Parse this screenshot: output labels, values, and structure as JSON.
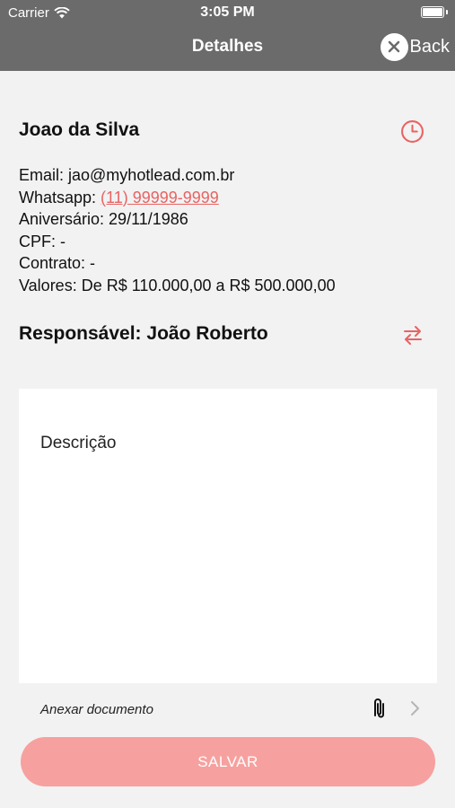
{
  "status_bar": {
    "carrier": "Carrier",
    "time": "3:05 PM"
  },
  "nav": {
    "title": "Detalhes",
    "back_label": "Back"
  },
  "contact": {
    "name": "Joao da Silva",
    "email_label": "Email: ",
    "email": "jao@myhotlead.com.br",
    "whatsapp_label": "Whatsapp: ",
    "whatsapp": "(11) 99999-9999",
    "aniversario_label": "Aniversário: ",
    "aniversario": "29/11/1986",
    "cpf_label": "CPF: ",
    "cpf": "-",
    "contrato_label": "Contrato: ",
    "contrato": "-",
    "valores_label": "Valores: ",
    "valores": "De R$ 110.000,00 a R$ 500.000,00"
  },
  "responsavel": {
    "text": "Responsável: João Roberto"
  },
  "description": {
    "placeholder": "Descrição"
  },
  "attachment": {
    "label": "Anexar documento"
  },
  "save_button": {
    "label": "SALVAR"
  },
  "colors": {
    "accent": "#e96363",
    "nav_bg": "#6b6b6b",
    "save_bg": "#f6a19f",
    "page_bg": "#f2f2f2"
  },
  "icons": {
    "history": "clock-icon",
    "swap": "swap-arrows-icon",
    "attach": "paperclip-icon",
    "navigate": "chevron-right-icon",
    "close": "close-icon"
  }
}
